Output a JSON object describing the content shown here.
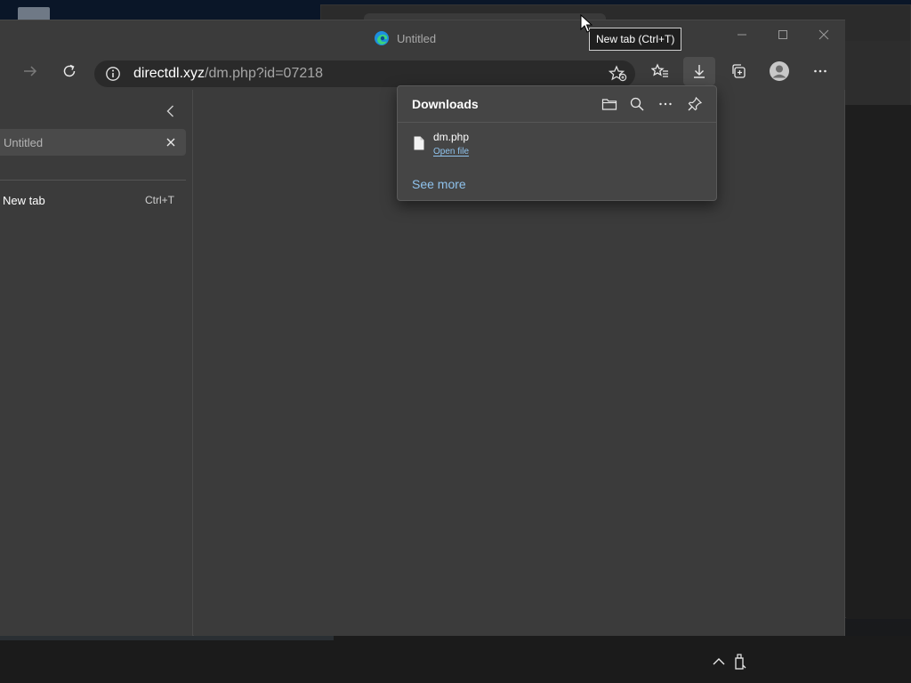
{
  "window": {
    "title": "Untitled"
  },
  "tooltip": {
    "text": "New tab (Ctrl+T)"
  },
  "address_bar": {
    "domain": "directdl.xyz",
    "path": "/dm.php?id=07218"
  },
  "sidebar": {
    "search_tab_label": "Untitled",
    "new_tab_label": "New tab",
    "new_tab_shortcut": "Ctrl+T"
  },
  "downloads": {
    "title": "Downloads",
    "items": [
      {
        "filename": "dm.php",
        "action": "Open file"
      }
    ],
    "see_more": "See more"
  },
  "icons": {
    "back_arrow": "forward-arrow-icon",
    "refresh": "refresh-icon",
    "favorites": "favorites-icon",
    "downloads": "download-icon",
    "collections": "collections-icon",
    "profile": "profile-icon",
    "menu": "more-icon"
  },
  "colors": {
    "window_bg": "#3b3b3b",
    "link": "#8fc2ec",
    "flyout_bg": "#454545"
  }
}
